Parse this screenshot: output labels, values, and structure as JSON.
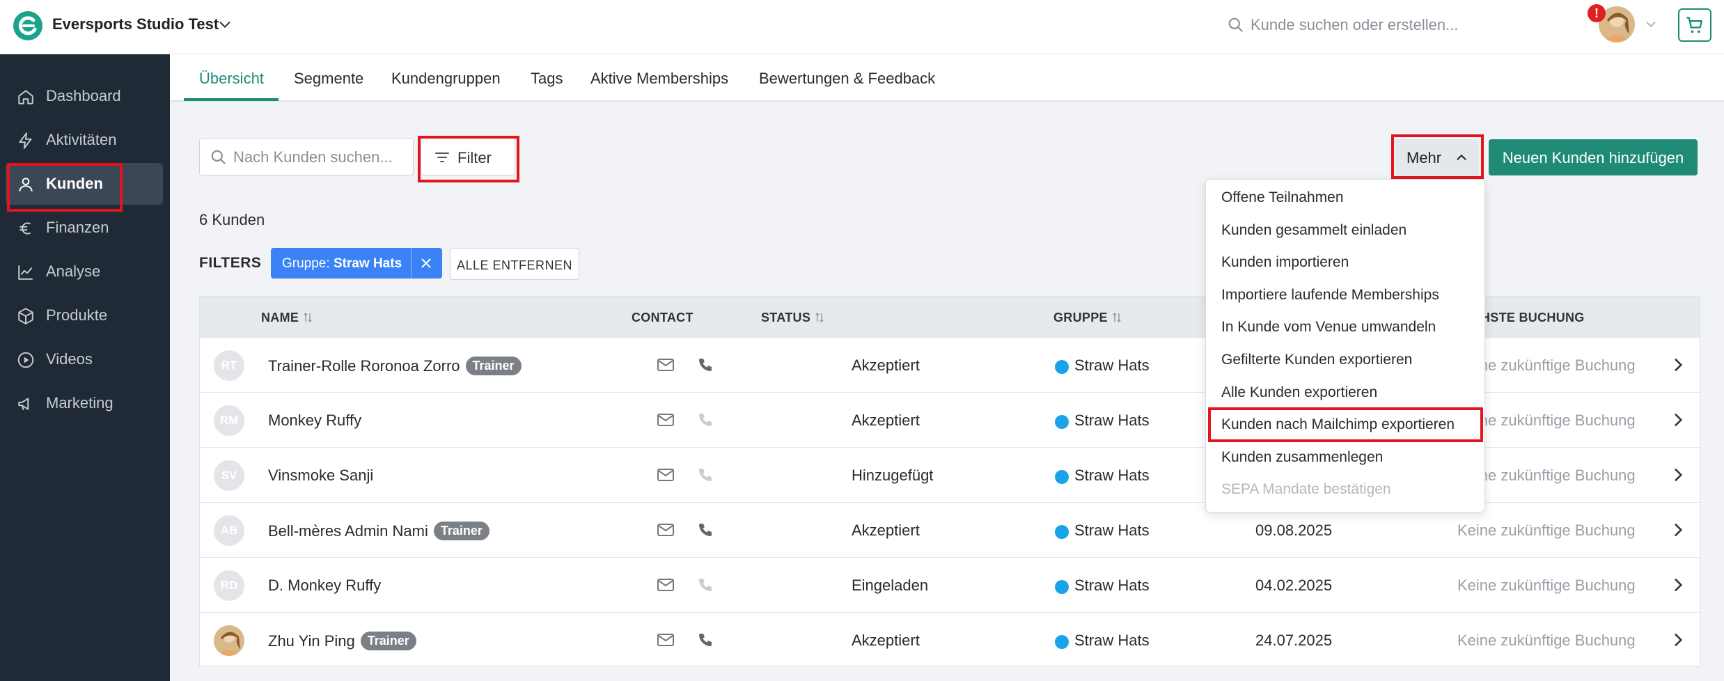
{
  "header": {
    "studio_name": "Eversports Studio Test",
    "search_placeholder": "Kunde suchen oder erstellen...",
    "notification_badge": "!"
  },
  "sidebar": {
    "items": [
      {
        "label": "Dashboard",
        "icon": "home-icon"
      },
      {
        "label": "Aktivitäten",
        "icon": "lightning-icon"
      },
      {
        "label": "Kunden",
        "icon": "user-icon",
        "active": true
      },
      {
        "label": "Finanzen",
        "icon": "euro-icon"
      },
      {
        "label": "Analyse",
        "icon": "chart-line-icon"
      },
      {
        "label": "Produkte",
        "icon": "box-icon"
      },
      {
        "label": "Videos",
        "icon": "play-circle-icon"
      },
      {
        "label": "Marketing",
        "icon": "megaphone-icon"
      }
    ]
  },
  "tabs": [
    "Übersicht",
    "Segmente",
    "Kundengruppen",
    "Tags",
    "Aktive Memberships",
    "Bewertungen & Feedback"
  ],
  "toolbar": {
    "search_placeholder": "Nach Kunden suchen...",
    "filter_label": "Filter",
    "mehr_label": "Mehr",
    "add_label": "Neuen Kunden hinzufügen"
  },
  "count_text": "6 Kunden",
  "filters": {
    "label": "FILTERS",
    "chip_prefix": "Gruppe:",
    "chip_value": "Straw Hats",
    "clear_label": "ALLE ENTFERNEN"
  },
  "table": {
    "headers": {
      "name": "NAME",
      "contact": "CONTACT",
      "status": "STATUS",
      "group": "GRUPPE",
      "next": "HSTE BUCHUNG"
    },
    "rows": [
      {
        "initials": "RT",
        "name": "Trainer-Rolle Roronoa Zorro",
        "badge": "Trainer",
        "status": "Akzeptiert",
        "group": "Straw Hats",
        "date": "",
        "next": "Keine zukünftige Buchung",
        "phone_active": true
      },
      {
        "initials": "RM",
        "name": "Monkey Ruffy",
        "badge": "",
        "status": "Akzeptiert",
        "group": "Straw Hats",
        "date": "",
        "next": "Keine zukünftige Buchung",
        "phone_active": false
      },
      {
        "initials": "SV",
        "name": "Vinsmoke Sanji",
        "badge": "",
        "status": "Hinzugefügt",
        "group": "Straw Hats",
        "date": "",
        "next": "Keine zukünftige Buchung",
        "phone_active": false
      },
      {
        "initials": "AB",
        "name": "Bell-mères Admin Nami",
        "badge": "Trainer",
        "status": "Akzeptiert",
        "group": "Straw Hats",
        "date": "09.08.2025",
        "next": "Keine zukünftige Buchung",
        "phone_active": true
      },
      {
        "initials": "RD",
        "name": "D. Monkey Ruffy",
        "badge": "",
        "status": "Eingeladen",
        "group": "Straw Hats",
        "date": "04.02.2025",
        "next": "Keine zukünftige Buchung",
        "phone_active": false
      },
      {
        "initials": "",
        "name": "Zhu Yin Ping",
        "badge": "Trainer",
        "status": "Akzeptiert",
        "group": "Straw Hats",
        "date": "24.07.2025",
        "next": "Keine zukünftige Buchung",
        "phone_active": true,
        "photo": true
      }
    ]
  },
  "menu": {
    "items": [
      {
        "label": "Offene Teilnahmen",
        "disabled": false
      },
      {
        "label": "Kunden gesammelt einladen",
        "disabled": false
      },
      {
        "label": "Kunden importieren",
        "disabled": false
      },
      {
        "label": "Importiere laufende Memberships",
        "disabled": false
      },
      {
        "label": "In Kunde vom Venue umwandeln",
        "disabled": false
      },
      {
        "label": "Gefilterte Kunden exportieren",
        "disabled": false
      },
      {
        "label": "Alle Kunden exportieren",
        "disabled": false
      },
      {
        "label": "Kunden nach Mailchimp exportieren",
        "disabled": false,
        "highlighted": true
      },
      {
        "label": "Kunden zusammenlegen",
        "disabled": false
      },
      {
        "label": "SEPA Mandate bestätigen",
        "disabled": true
      }
    ]
  },
  "colors": {
    "brand": "#1f8a76",
    "sidebar_bg": "#1f2a36",
    "chip": "#3b82f6",
    "group_dot": "#1aa3e8",
    "highlight": "#e3141b"
  }
}
